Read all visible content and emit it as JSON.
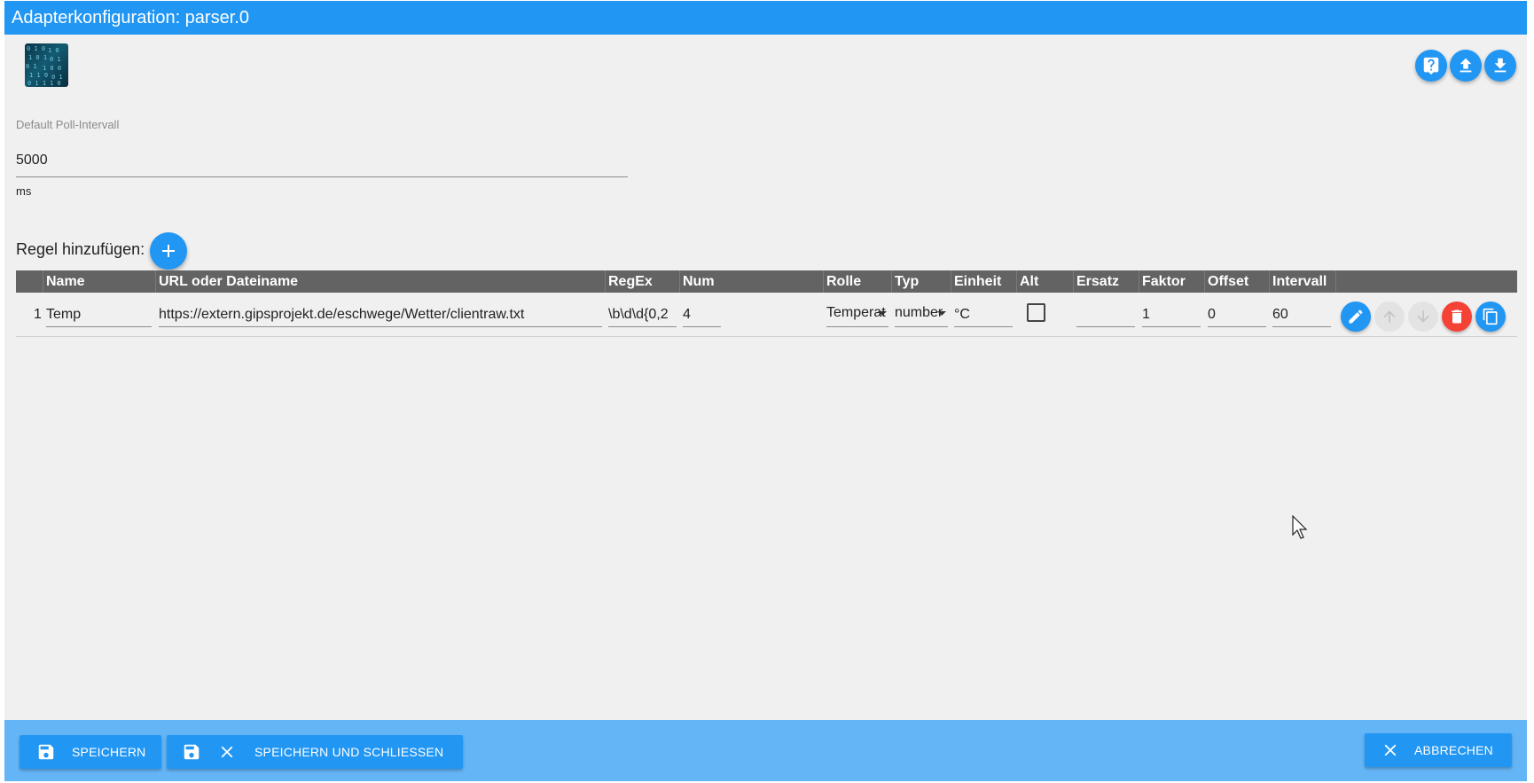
{
  "window": {
    "title": "Adapterkonfiguration: parser.0"
  },
  "toolbar": {
    "help_icon": "help-icon",
    "upload_icon": "upload-icon",
    "download_icon": "download-icon"
  },
  "poll": {
    "label": "Default Poll-Intervall",
    "value": "5000",
    "unit": "ms"
  },
  "rules": {
    "add_label": "Regel hinzufügen:",
    "columns": [
      "Name",
      "URL oder Dateiname",
      "RegEx",
      "Num",
      "Rolle",
      "Typ",
      "Einheit",
      "Alt",
      "Ersatz",
      "Faktor",
      "Offset",
      "Intervall"
    ],
    "rows": [
      {
        "index": "1",
        "name": "Temp",
        "url": "https://extern.gipsprojekt.de/eschwege/Wetter/clientraw.txt",
        "regex": "\\b\\d\\d{0,2",
        "num": "4",
        "rolle": "Temperat",
        "typ": "number",
        "einheit": "°C",
        "alt": false,
        "ersatz": "",
        "faktor": "1",
        "offset": "0",
        "intervall": "60"
      }
    ]
  },
  "footer": {
    "save": "SPEICHERN",
    "save_close": "SPEICHERN UND SCHLIESSEN",
    "cancel": "ABBRECHEN"
  },
  "colors": {
    "primary": "#2196f3",
    "footer_bg": "#64b5f6",
    "delete": "#f44336",
    "table_header": "#636363"
  }
}
